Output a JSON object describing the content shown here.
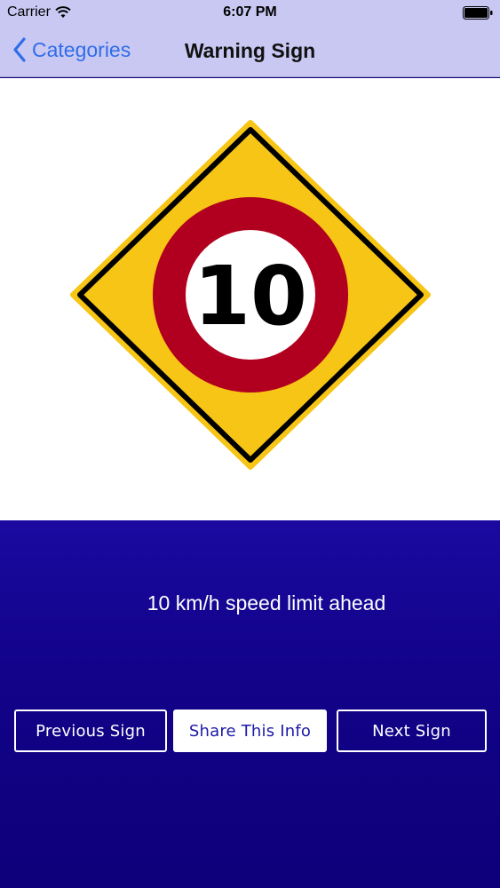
{
  "status_bar": {
    "carrier": "Carrier",
    "time": "6:07 PM"
  },
  "nav": {
    "back_label": "Categories",
    "title": "Warning Sign"
  },
  "sign": {
    "speed_value": "10",
    "colors": {
      "diamond": "#f7c515",
      "ring": "#b1001f",
      "inner": "#ffffff",
      "border": "#000000"
    }
  },
  "description": "10 km/h speed limit ahead",
  "buttons": {
    "previous": "Previous Sign",
    "share": "Share This Info",
    "next": "Next Sign"
  }
}
